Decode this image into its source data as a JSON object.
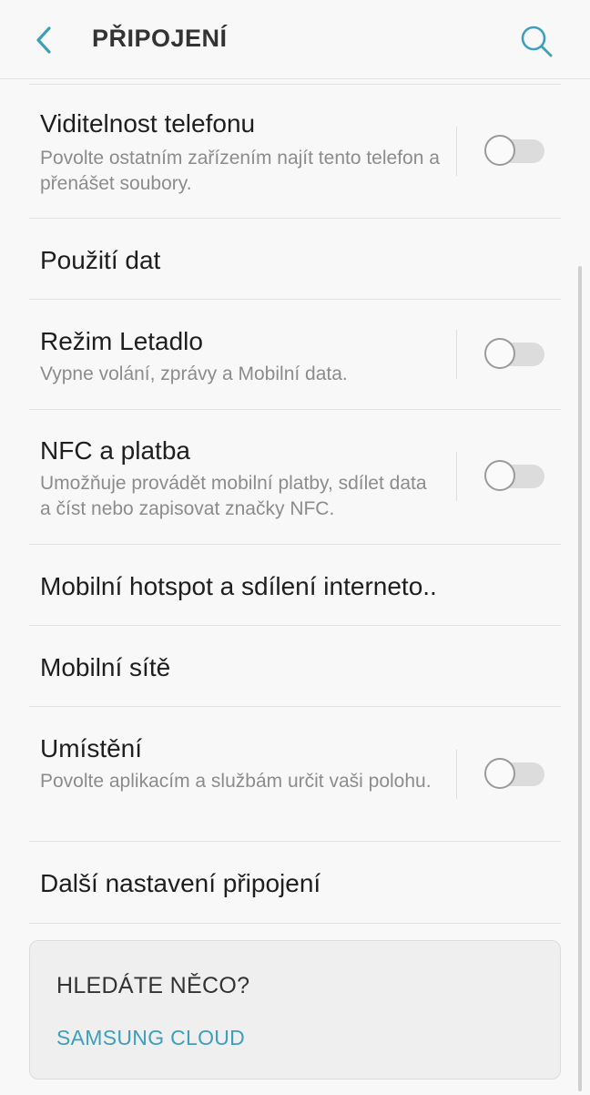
{
  "header": {
    "title": "PŘIPOJENÍ",
    "back_icon": "chevron-left-icon",
    "search_icon": "search-icon",
    "accent_color": "#3d9fba"
  },
  "settings": {
    "visibility": {
      "title": "Viditelnost telefonu",
      "subtitle": "Povolte ostatním zařízením najít tento telefon a přenášet soubory.",
      "enabled": false
    },
    "data_usage": {
      "title": "Použití dat"
    },
    "airplane": {
      "title": "Režim Letadlo",
      "subtitle": "Vypne volání, zprávy a Mobilní data.",
      "enabled": false
    },
    "nfc": {
      "title": "NFC a platba",
      "subtitle": "Umožňuje provádět mobilní platby, sdílet data a číst nebo zapisovat značky NFC.",
      "enabled": false
    },
    "hotspot": {
      "title": "Mobilní hotspot a sdílení interneto.."
    },
    "mobile_networks": {
      "title": "Mobilní sítě"
    },
    "location": {
      "title": "Umístění",
      "subtitle": "Povolte aplikacím a službám určit vaši polohu.",
      "enabled": false
    },
    "more": {
      "title": "Další nastavení připojení"
    }
  },
  "suggestion_card": {
    "title": "HLEDÁTE NĚCO?",
    "link": "SAMSUNG CLOUD"
  }
}
